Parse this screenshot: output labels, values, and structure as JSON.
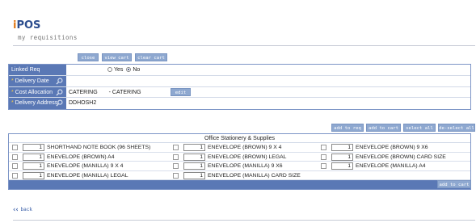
{
  "app": {
    "logo_prefix": "i",
    "logo_rest": "POS",
    "subtitle": "my requisitions"
  },
  "toolbar": {
    "close": "close",
    "view_cart": "view cart",
    "clear_cart": "clear cart"
  },
  "form": {
    "linked_req": {
      "label": "Linked Req",
      "yes": "Yes",
      "no": "No",
      "selected": "No"
    },
    "delivery_date": {
      "label": "Delivery Date",
      "value": ""
    },
    "cost_allocation": {
      "label": "Cost Allocation",
      "code": "CATERING",
      "name": "- CATERING",
      "edit_label": "edit"
    },
    "delivery_address": {
      "label": "Delivery Address",
      "value": "DDHOSH2"
    },
    "required_mark": "*"
  },
  "actions": {
    "add_to_req": "add to req",
    "add_to_cart": "add to cart",
    "select_all": "select all",
    "deselect_all": "de-select all"
  },
  "catalog": {
    "title": "Office Stationery & Supplies",
    "rows": [
      [
        {
          "qty": "1",
          "name": "SHORTHAND NOTE BOOK (96 SHEETS)"
        },
        {
          "qty": "1",
          "name": "ENEVELOPE (BROWN) 9 X 4"
        },
        {
          "qty": "1",
          "name": "ENEVELOPE (BROWN) 9 X6"
        }
      ],
      [
        {
          "qty": "1",
          "name": "ENEVELOPE (BROWN) A4"
        },
        {
          "qty": "1",
          "name": "ENEVELOPE (BROWN) LEGAL"
        },
        {
          "qty": "1",
          "name": "ENEVELOPE (BROWN) CARD SIZE"
        }
      ],
      [
        {
          "qty": "1",
          "name": "ENEVELOPE (MANILLA) 9 X 4"
        },
        {
          "qty": "1",
          "name": "ENEVELOPE (MANILLA) 9 X6"
        },
        {
          "qty": "1",
          "name": "ENEVELOPE (MANILLA) A4"
        }
      ],
      [
        {
          "qty": "1",
          "name": "ENEVELOPE (MANILLA) LEGAL"
        },
        {
          "qty": "1",
          "name": "ENEVELOPE (MANILLA) CARD SIZE"
        }
      ]
    ],
    "footer_add_to_cart": "add to cart"
  },
  "nav": {
    "back": "back"
  },
  "colors": {
    "accent": "#5a78b5",
    "button": "#8ea8d0",
    "logo": "#2c4d8e",
    "logo_i": "#e07a1a"
  },
  "icons": {
    "lookup": "magnifier-icon",
    "back": "double-chevron-left-icon"
  }
}
